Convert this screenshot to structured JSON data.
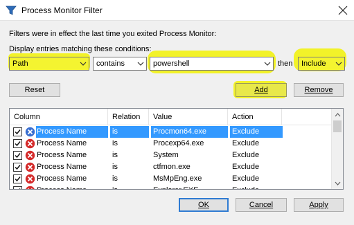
{
  "window": {
    "title": "Process Monitor Filter",
    "icon": "process-monitor-filter-icon"
  },
  "text": {
    "info": "Filters were in effect the last time you exited Process Monitor:",
    "display_label": "Display entries matching these conditions:",
    "then": "then"
  },
  "filter_row": {
    "column": "Path",
    "relation": "contains",
    "value": "powershell",
    "action": "Include"
  },
  "buttons": {
    "reset": "Reset",
    "add": "Add",
    "remove": "Remove",
    "ok": "OK",
    "cancel": "Cancel",
    "apply": "Apply"
  },
  "table": {
    "headers": [
      "Column",
      "Relation",
      "Value",
      "Action"
    ],
    "rows": [
      {
        "checked": true,
        "status": "include-icon",
        "column": "Process Name",
        "relation": "is",
        "value": "Procmon64.exe",
        "action": "Exclude",
        "selected": true
      },
      {
        "checked": true,
        "status": "exclude-icon",
        "column": "Process Name",
        "relation": "is",
        "value": "Procexp64.exe",
        "action": "Exclude"
      },
      {
        "checked": true,
        "status": "exclude-icon",
        "column": "Process Name",
        "relation": "is",
        "value": "System",
        "action": "Exclude"
      },
      {
        "checked": true,
        "status": "exclude-icon",
        "column": "Process Name",
        "relation": "is",
        "value": "ctfmon.exe",
        "action": "Exclude"
      },
      {
        "checked": true,
        "status": "exclude-icon",
        "column": "Process Name",
        "relation": "is",
        "value": "MsMpEng.exe",
        "action": "Exclude"
      },
      {
        "checked": true,
        "status": "exclude-icon",
        "column": "Process Name",
        "relation": "is",
        "value": "Explorer.EXE",
        "action": "Exclude"
      }
    ]
  },
  "colors": {
    "highlight": "#f2f229",
    "selection": "#3399ff",
    "exclude_icon": "#d42a2a",
    "include_icon": "#3a6fd0"
  }
}
